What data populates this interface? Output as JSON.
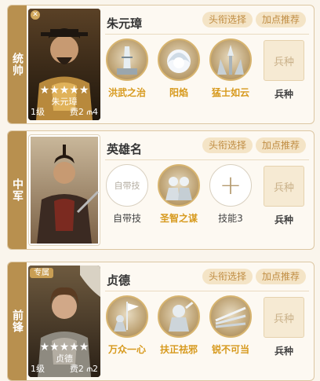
{
  "slots": [
    {
      "role": "统帅",
      "hero_name": "朱元璋",
      "portrait": {
        "name": "朱元璋",
        "stars": "★★★★★",
        "level": "1级",
        "cost": "费2 ⫙4",
        "badge": ""
      },
      "title_button": "头衔选择",
      "points_button": "加点推荐",
      "skills": [
        {
          "label": "洪武之治",
          "icon": "fortress-icon"
        },
        {
          "label": "阳焰",
          "icon": "flame-burst-icon"
        },
        {
          "label": "猛士如云",
          "icon": "warriors-icon"
        }
      ],
      "troop_button": "兵种",
      "troop_label": "兵种"
    },
    {
      "role": "中军",
      "hero_name": "英雄名",
      "portrait": {
        "name": "",
        "stars": "",
        "level": "",
        "cost": "",
        "badge": ""
      },
      "title_button": "头衔选择",
      "points_button": "加点推荐",
      "skills": [
        {
          "label": "自带技",
          "placeholder": "自带技",
          "type": "empty"
        },
        {
          "label": "圣智之谋",
          "icon": "strategists-icon"
        },
        {
          "label": "技能3",
          "type": "add"
        }
      ],
      "troop_button": "兵种",
      "troop_label": "兵种"
    },
    {
      "role": "前锋",
      "hero_name": "贞德",
      "portrait": {
        "name": "贞德",
        "stars": "★★★★★",
        "level": "1级",
        "cost": "费2 ⫙2",
        "badge": "专属"
      },
      "title_button": "头衔选择",
      "points_button": "加点推荐",
      "skills": [
        {
          "label": "万众一心",
          "icon": "rally-icon"
        },
        {
          "label": "扶正祛邪",
          "icon": "knight-icon"
        },
        {
          "label": "锐不可当",
          "icon": "spears-icon"
        }
      ],
      "troop_button": "兵种",
      "troop_label": "兵种"
    }
  ],
  "colors": {
    "accent": "#b8904f",
    "skill_label": "#d79a1e",
    "pill_bg": "#f4e4c6"
  }
}
